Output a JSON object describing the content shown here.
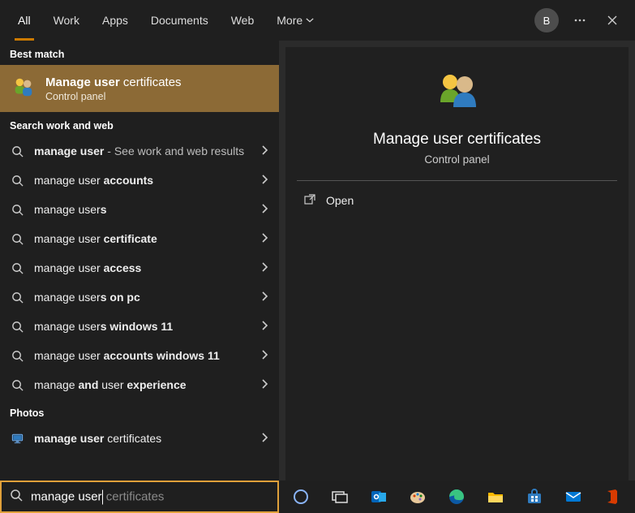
{
  "tabs": {
    "items": [
      "All",
      "Work",
      "Apps",
      "Documents",
      "Web",
      "More"
    ],
    "active_index": 0
  },
  "avatar_initial": "B",
  "left": {
    "best_match_header": "Best match",
    "best_match": {
      "title_bold": "Manage user",
      "title_rest": " certificates",
      "subtitle": "Control panel"
    },
    "search_header": "Search work and web",
    "suggestions": [
      {
        "pre": "",
        "bold": "manage user",
        "post": "",
        "suffix_dim": " - See work and web results"
      },
      {
        "pre": "manage user ",
        "bold": "accounts",
        "post": "",
        "suffix_dim": ""
      },
      {
        "pre": "manage user",
        "bold": "s",
        "post": "",
        "suffix_dim": ""
      },
      {
        "pre": "manage user ",
        "bold": "certificate",
        "post": "",
        "suffix_dim": ""
      },
      {
        "pre": "manage user ",
        "bold": "access",
        "post": "",
        "suffix_dim": ""
      },
      {
        "pre": "manage user",
        "bold": "s on pc",
        "post": "",
        "suffix_dim": ""
      },
      {
        "pre": "manage user",
        "bold": "s windows 11",
        "post": "",
        "suffix_dim": ""
      },
      {
        "pre": "manage user ",
        "bold": "accounts windows 11",
        "post": "",
        "suffix_dim": ""
      },
      {
        "pre": "manage ",
        "bold": "and",
        "post": " user ",
        "bold2": "experience",
        "suffix_dim": ""
      }
    ],
    "photos_header": "Photos",
    "photos_items": [
      {
        "pre": "",
        "bold": "manage user",
        "post": " certificates"
      }
    ]
  },
  "preview": {
    "title": "Manage user certificates",
    "subtitle": "Control panel",
    "actions": [
      {
        "label": "Open"
      }
    ]
  },
  "search": {
    "typed": "manage user",
    "hint": " certificates"
  },
  "taskbar": {
    "items": [
      "cortana",
      "task-view",
      "outlook",
      "paint",
      "edge",
      "file-explorer",
      "microsoft-store",
      "mail",
      "office"
    ]
  }
}
